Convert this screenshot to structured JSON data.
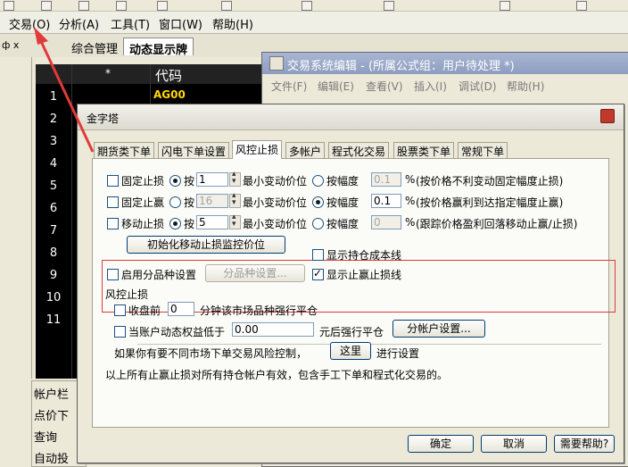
{
  "menubar": {
    "items": [
      "交易(O)",
      "分析(A)",
      "工具(T)",
      "窗口(W)",
      "帮助(H)"
    ]
  },
  "left_panel": {
    "pin_label": "ф x"
  },
  "tabbar": {
    "tabs": [
      "综合管理",
      "动态显示牌"
    ]
  },
  "grid": {
    "headers": [
      "*",
      "代码"
    ],
    "rows": [
      "1",
      "2",
      "3",
      "4",
      "5",
      "6",
      "7",
      "8",
      "9",
      "10",
      "11"
    ],
    "first_code": "AG00"
  },
  "bottom_panel": {
    "title": "帐户栏",
    "items": [
      "点价下",
      "查询",
      "自动投"
    ]
  },
  "editor": {
    "title": "交易系统编辑 - (所属公式组：用户待处理 *)",
    "menu": [
      "文件(F)",
      "编辑(E)",
      "查看(V)",
      "插入(I)",
      "调试(D)",
      "帮助(H)"
    ]
  },
  "dialog": {
    "title": "金字塔",
    "tabs": [
      "期货类下单",
      "闪电下单设置",
      "风控止损",
      "多帐户",
      "程式化交易",
      "股票类下单",
      "常规下单"
    ],
    "active_tab": "风控止损",
    "stop_loss": {
      "fixed_loss": "固定止损",
      "fixed_profit": "固定止赢",
      "moving_loss": "移动止损",
      "by_label": "按",
      "min_tick": "最小变动价位",
      "by_amp": "按幅度",
      "pct": "%",
      "loss_value": "1",
      "profit_value": "16",
      "moving_value": "5",
      "loss_amp": "0.1",
      "profit_amp": "0.1",
      "moving_amp": "0",
      "loss_note": "(按价格不利变动固定幅度止损)",
      "profit_note": "(按价格赢利到达指定幅度止赢)",
      "moving_note": "(跟踪价格盈利回落移动止赢/止损)",
      "init_button": "初始化移动止损监控价位",
      "show_cost_line": "显示持仓成本线",
      "enable_per_variety": "启用分品种设置",
      "per_variety_button": "分品种设置...",
      "show_stop_line": "显示止赢止损线"
    },
    "risk": {
      "group_label": "风控止损",
      "close_before": "收盘前",
      "close_before_value": "0",
      "close_before_suffix": "分钟该市场品种强行平仓",
      "equity_below": "当账户动态权益低于",
      "equity_value": "0.00",
      "equity_suffix": "元后强行平仓",
      "account_button": "分帐户设置...",
      "per_market_text": "如果你有要不同市场下单交易风险控制，",
      "here_button": "这里",
      "per_market_suffix": "进行设置",
      "footnote": "以上所有止赢止损对所有持仓帐户有效，包含手工下单和程式化交易的。"
    },
    "buttons": {
      "ok": "确定",
      "cancel": "取消",
      "help": "需要帮助?"
    }
  },
  "colors": {
    "accent_red": "#e03a3a",
    "code_yellow": "#ffd800",
    "grid_bg": "#000000"
  }
}
